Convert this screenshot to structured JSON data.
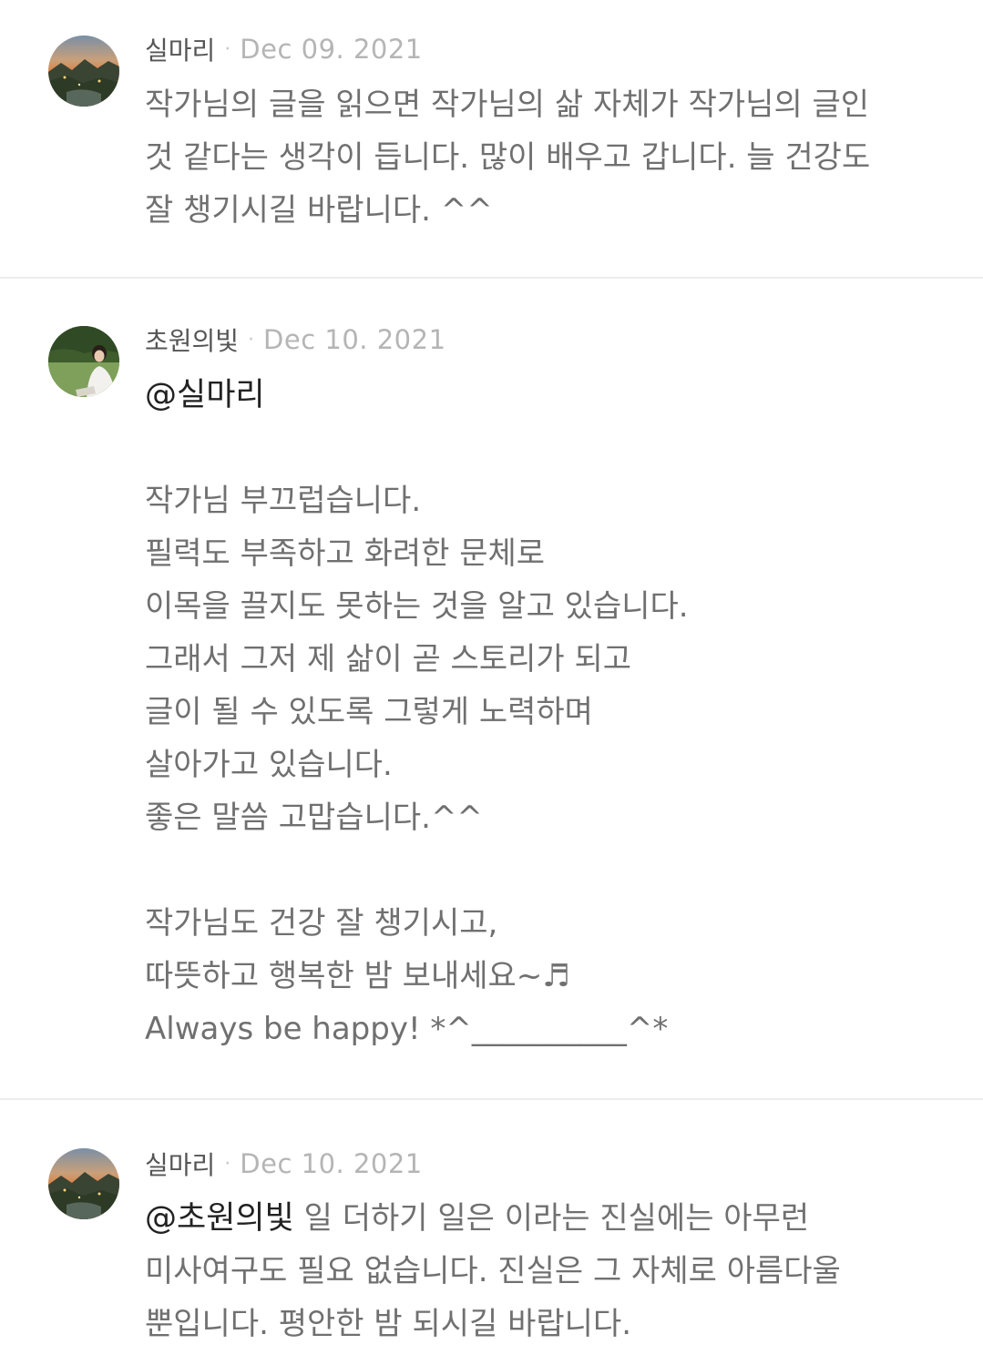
{
  "comments": [
    {
      "author": "실마리",
      "separator": "·",
      "date": "Dec 09. 2021",
      "avatar_icon": "sunset-landscape-avatar",
      "lines": [
        "작가님의 글을 읽으면 작가님의 삶 자체가 작가님의 글인",
        "것 같다는 생각이 듭니다. 많이 배우고 갑니다. 늘 건강도",
        "잘 챙기시길 바랍니다. ^^"
      ]
    },
    {
      "author": "초원의빛",
      "separator": "·",
      "date": "Dec 10. 2021",
      "avatar_icon": "woman-in-field-avatar",
      "mention": "@실마리",
      "paragraph1": [
        "작가님 부끄럽습니다.",
        "필력도 부족하고 화려한 문체로",
        "이목을 끌지도 못하는 것을 알고 있습니다.",
        "그래서 그저 제 삶이 곧 스토리가 되고",
        "글이 될 수 있도록 그렇게 노력하며",
        "살아가고 있습니다.",
        "좋은 말씀 고맙습니다.^^"
      ],
      "paragraph2": [
        "작가님도 건강 잘 챙기시고,",
        "따뜻하고 행복한 밤 보내세요~♬",
        "Always be happy! *^__________^*"
      ]
    },
    {
      "author": "실마리",
      "separator": "·",
      "date": "Dec 10. 2021",
      "avatar_icon": "sunset-landscape-avatar",
      "mention": "@초원의빛",
      "first_line_rest": " 일 더하기 일은 이라는 진실에는 아무런",
      "lines": [
        "미사여구도 필요 없습니다. 진실은 그 자체로 아름다울",
        "뿐입니다. 평안한 밤 되시길 바랍니다."
      ]
    }
  ]
}
